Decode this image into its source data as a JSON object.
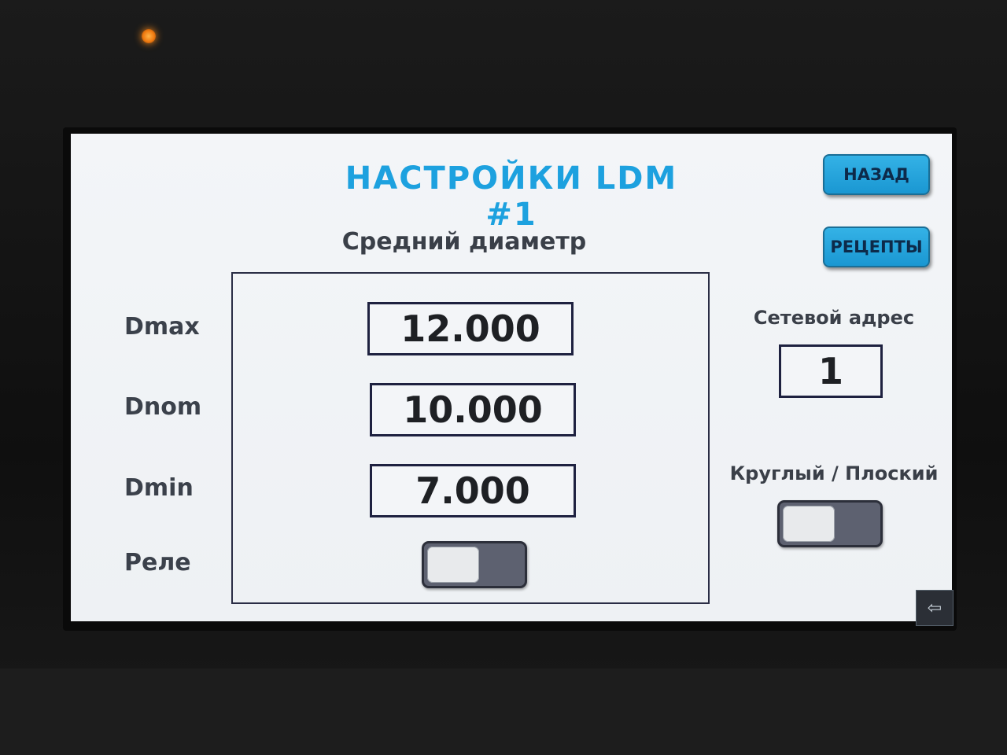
{
  "header": {
    "title": "НАСТРОЙКИ LDM #1",
    "back_label": "НАЗАД",
    "recipes_label": "РЕЦЕПТЫ"
  },
  "main": {
    "section_title": "Средний диаметр",
    "rows": [
      {
        "label": "Dmax",
        "value": "12.000"
      },
      {
        "label": "Dnom",
        "value": "10.000"
      },
      {
        "label": "Dmin",
        "value": "7.000"
      }
    ],
    "relay_label": "Реле",
    "relay_on": false
  },
  "side": {
    "address_label": "Сетевой адрес",
    "address_value": "1",
    "shape_label": "Круглый / Плоский",
    "shape_flat": false
  },
  "icons": {
    "corner": "back-arrow-icon",
    "indicator": "status-led"
  },
  "colors": {
    "title": "#1da1df",
    "button": "#1a97d2",
    "led": "#f07a10"
  }
}
